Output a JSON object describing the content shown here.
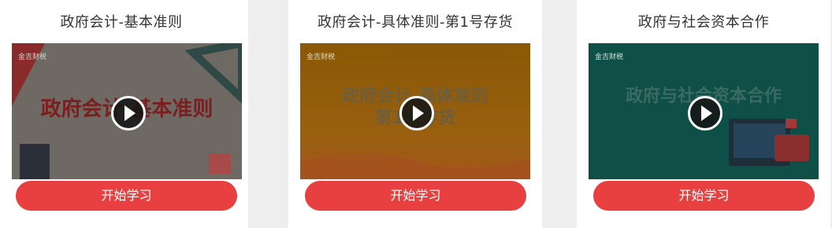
{
  "courses": [
    {
      "title": "政府会计-基本准则",
      "thumb_text": "政府会计-基本准则",
      "logo": "金吉财税",
      "button_label": "开始学习"
    },
    {
      "title": "政府会计-具体准则-第1号存货",
      "thumb_text_line1": "政府会计-具体准则",
      "thumb_text_line2": "第1号存货",
      "logo": "金吉财税",
      "button_label": "开始学习"
    },
    {
      "title": "政府与社会资本合作",
      "thumb_text": "政府与社会资本合作",
      "logo": "金吉财税",
      "button_label": "开始学习"
    }
  ],
  "colors": {
    "button": "#e84040",
    "thumb1_bg": "#6f6a63",
    "thumb2_bg": "#8a5a06",
    "thumb3_bg": "#0f5048"
  },
  "icons": {
    "play": "play-icon"
  }
}
